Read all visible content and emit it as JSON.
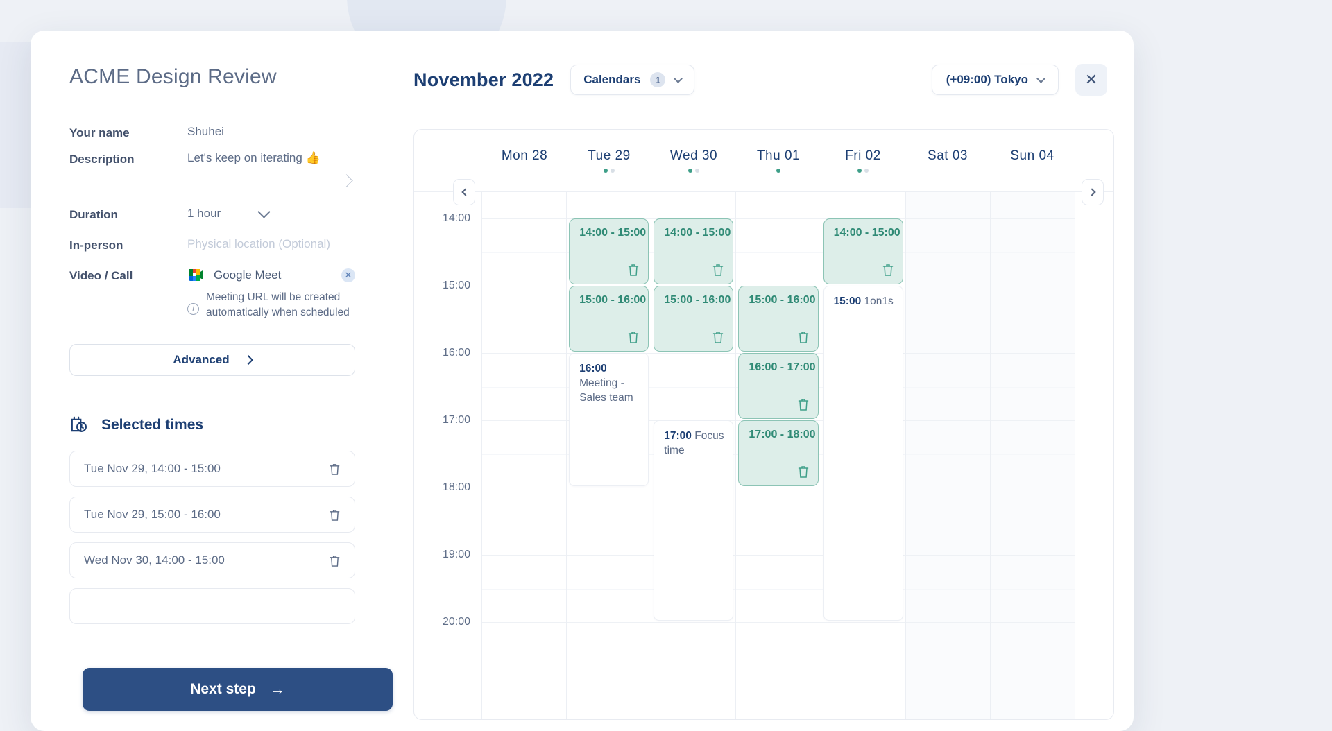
{
  "left": {
    "event_title": "ACME Design Review",
    "fields": [
      {
        "label": "Your name",
        "value": "Shuhei",
        "placeholder": ""
      },
      {
        "label": "Description",
        "value": "Let's keep on iterating 👍",
        "placeholder": ""
      },
      {
        "label": "Duration",
        "value": "1 hour",
        "placeholder": ""
      },
      {
        "label": "In-person",
        "value": "",
        "placeholder": "Physical location (Optional)"
      },
      {
        "label": "Video / Call",
        "value": "Google Meet",
        "placeholder": ""
      }
    ],
    "video_hint": "Meeting URL will be created automatically when scheduled",
    "advanced_label": "Advanced",
    "selected_times_title": "Selected times",
    "selected_times": [
      "Tue Nov 29, 14:00 - 15:00",
      "Tue Nov 29, 15:00 - 16:00",
      "Wed Nov 30, 14:00 - 15:00"
    ],
    "next_label": "Next step"
  },
  "calendar": {
    "month": "November 2022",
    "calendars_label": "Calendars",
    "calendars_count": "1",
    "timezone": "(+09:00) Tokyo",
    "hours": [
      "14:00",
      "15:00",
      "16:00",
      "17:00",
      "18:00",
      "19:00",
      "20:00"
    ],
    "days": [
      {
        "name": "Mon 28",
        "weekend": false,
        "dots": []
      },
      {
        "name": "Tue 29",
        "weekend": false,
        "dots": [
          "on",
          "off"
        ]
      },
      {
        "name": "Wed 30",
        "weekend": false,
        "dots": [
          "on",
          "off"
        ]
      },
      {
        "name": "Thu 01",
        "weekend": false,
        "dots": [
          "on"
        ]
      },
      {
        "name": "Fri 02",
        "weekend": false,
        "dots": [
          "on",
          "off"
        ]
      },
      {
        "name": "Sat 03",
        "weekend": true,
        "dots": []
      },
      {
        "name": "Sun 04",
        "weekend": true,
        "dots": []
      }
    ],
    "events": [
      {
        "day": 1,
        "kind": "selected",
        "time": "14:00 - 15:00",
        "start": 14.0,
        "end": 15.0
      },
      {
        "day": 1,
        "kind": "selected",
        "time": "15:00 - 16:00",
        "start": 15.0,
        "end": 16.0
      },
      {
        "day": 1,
        "kind": "busy",
        "time": "16:00",
        "title": "Meeting - Sales team",
        "start": 16.0,
        "end": 18.0
      },
      {
        "day": 2,
        "kind": "selected",
        "time": "14:00 - 15:00",
        "start": 14.0,
        "end": 15.0
      },
      {
        "day": 2,
        "kind": "selected",
        "time": "15:00 - 16:00",
        "start": 15.0,
        "end": 16.0
      },
      {
        "day": 2,
        "kind": "busy",
        "time": "17:00",
        "title": "Focus time",
        "start": 17.0,
        "end": 20.0
      },
      {
        "day": 3,
        "kind": "selected",
        "time": "15:00 - 16:00",
        "start": 15.0,
        "end": 16.0
      },
      {
        "day": 3,
        "kind": "selected",
        "time": "16:00 - 17:00",
        "start": 16.0,
        "end": 17.0
      },
      {
        "day": 3,
        "kind": "selected",
        "time": "17:00 - 18:00",
        "start": 17.0,
        "end": 18.0
      },
      {
        "day": 4,
        "kind": "selected",
        "time": "14:00 - 15:00",
        "start": 14.0,
        "end": 15.0
      },
      {
        "day": 4,
        "kind": "busy",
        "time": "15:00",
        "title": "1on1s",
        "start": 15.0,
        "end": 20.0
      }
    ]
  },
  "colors": {
    "brand": "#1d3f73",
    "primary_button": "#2d4f84",
    "selected_event_bg": "#ddeee9",
    "selected_event_border": "#8cc4b5",
    "selected_event_text": "#2f8a75",
    "muted_text": "#5c6b86"
  }
}
